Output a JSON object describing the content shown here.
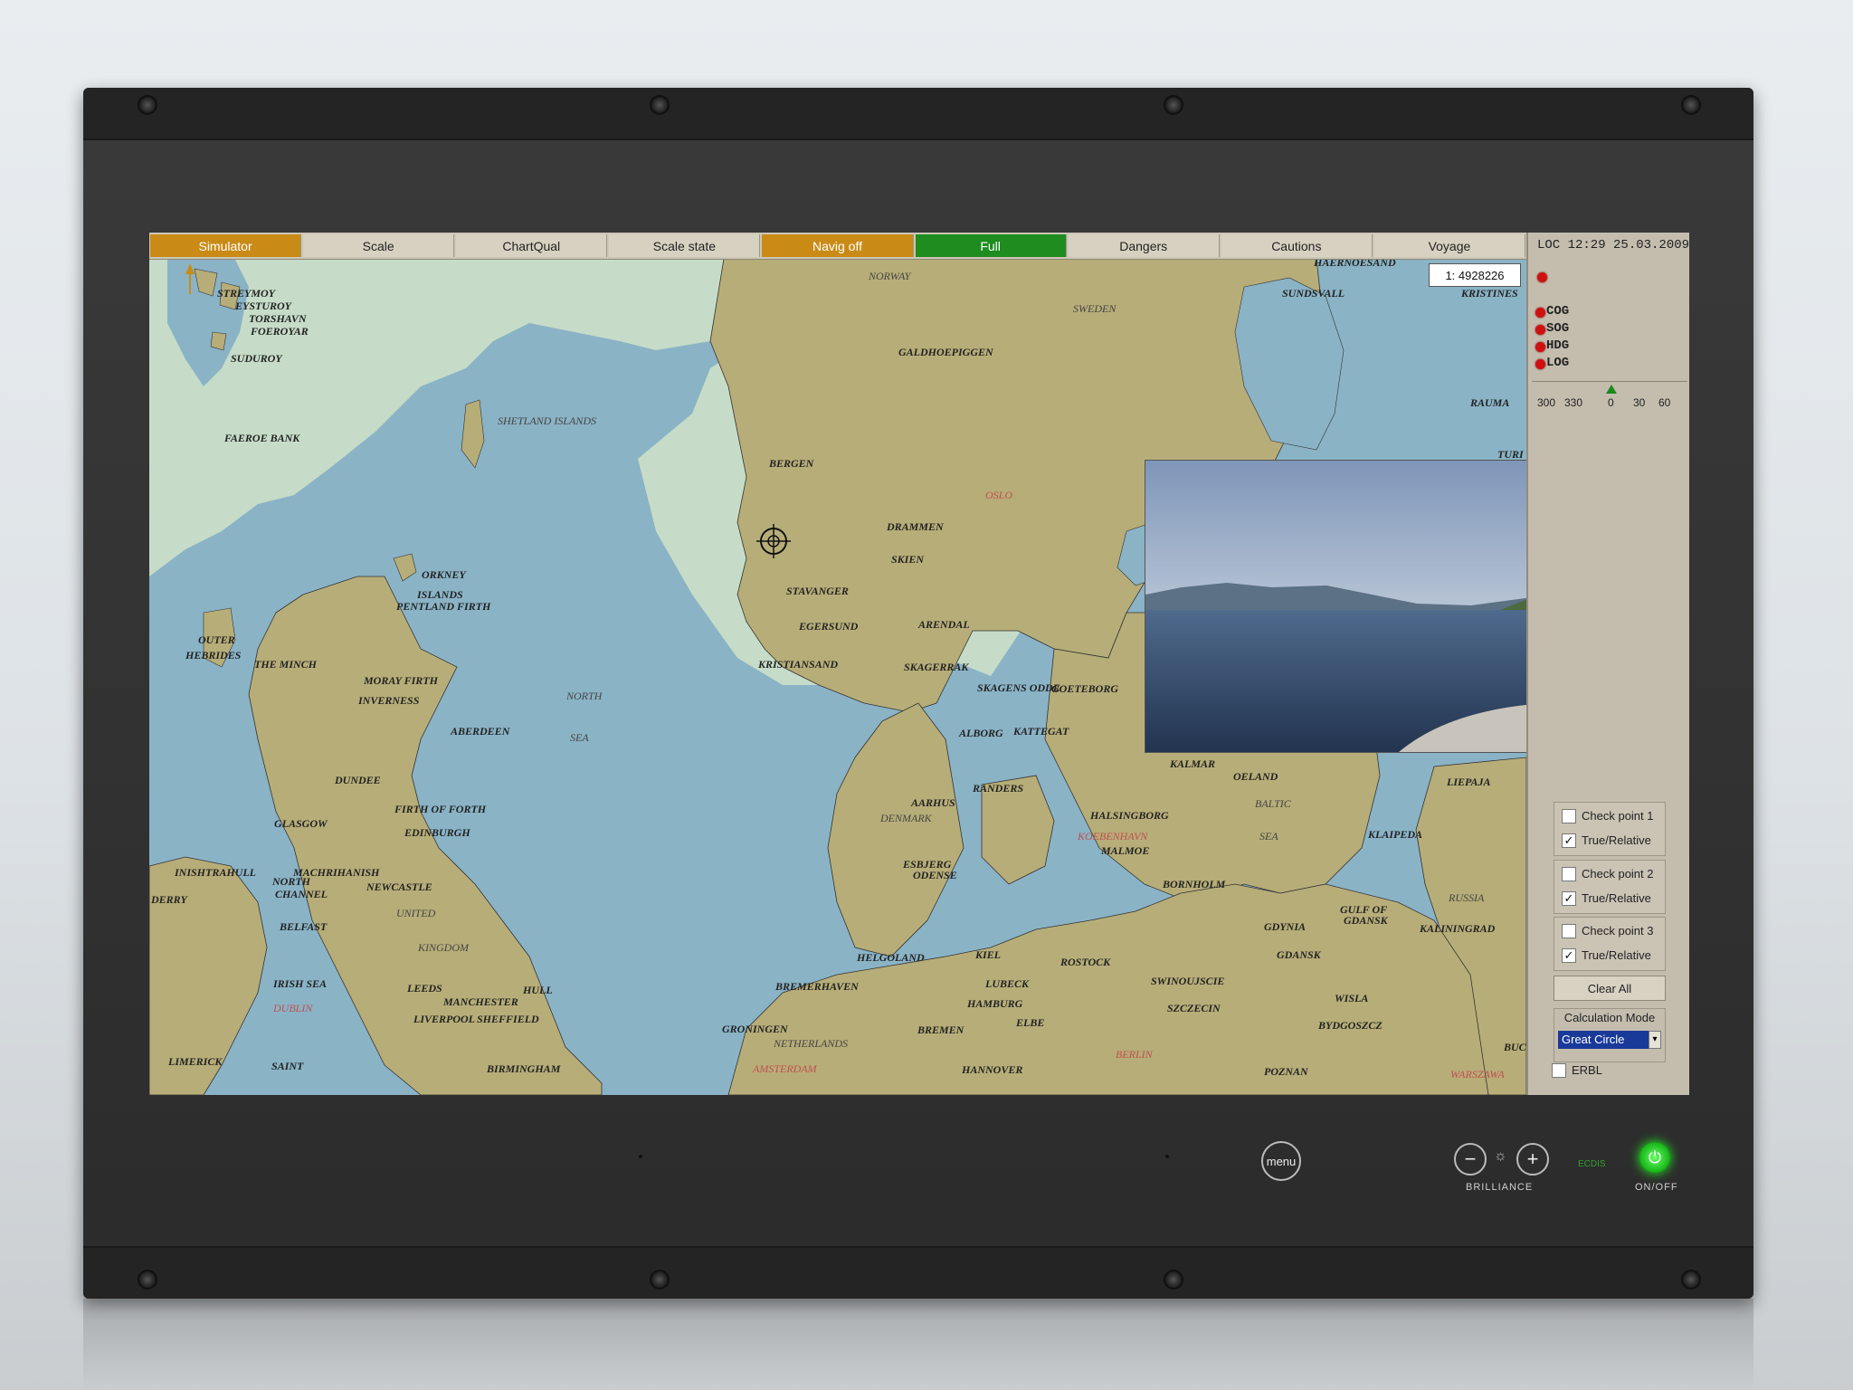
{
  "topbar": {
    "tabs": [
      "Simulator",
      "Scale",
      "ChartQual",
      "Scale state",
      "Navig off",
      "Full",
      "Dangers",
      "Cautions",
      "Voyage"
    ]
  },
  "status": {
    "loc_datetime": "LOC 12:29 25.03.2009",
    "scale": "1: 4928226"
  },
  "sensors": [
    "COG",
    "SOG",
    "HDG",
    "LOG"
  ],
  "compass_ticks": [
    "300",
    "330",
    "0",
    "30",
    "60"
  ],
  "checkpoints": [
    {
      "label": "Check point 1",
      "checked": false,
      "mode_label": "True/Relative",
      "mode_checked": true
    },
    {
      "label": "Check point 2",
      "checked": false,
      "mode_label": "True/Relative",
      "mode_checked": true
    },
    {
      "label": "Check point 3",
      "checked": false,
      "mode_label": "True/Relative",
      "mode_checked": true
    }
  ],
  "clear_all_label": "Clear All",
  "calculation": {
    "label": "Calculation Mode",
    "value": "Great Circle"
  },
  "erbl": {
    "label": "ERBL",
    "checked": false
  },
  "check_mark": "✓",
  "map_labels": {
    "norway": "NORWAY",
    "sweden": "SWEDEN",
    "haernoesand": "HAERNOESAND",
    "sundsvall": "SUNDSVALL",
    "kristines": "KRISTINES",
    "rauma": "RAUMA",
    "turi": "TURI",
    "streymoy": "STREYMOY",
    "eysturoy": "EYSTUROY",
    "torshavn": "TORSHAVN",
    "foeroyar": "FOEROYAR",
    "suduroy": "SUDUROY",
    "faeroe_bank": "FAEROE BANK",
    "shetland": "SHETLAND ISLANDS",
    "galdhoepiggen": "GALDHOEPIGGEN",
    "bergen": "BERGEN",
    "oslo": "OSLO",
    "drammen": "DRAMMEN",
    "skien": "SKIEN",
    "stavanger": "STAVANGER",
    "egersund": "EGERSUND",
    "arendal": "ARENDAL",
    "kristiansand": "KRISTIANSAND",
    "skagerrak": "SKAGERRAK",
    "orkney": "ORKNEY",
    "islands": "ISLANDS",
    "pentland": "PENTLAND FIRTH",
    "outer": "OUTER",
    "hebrides": "HEBRIDES",
    "the_minch": "THE MINCH",
    "moray": "MORAY FIRTH",
    "inverness": "INVERNESS",
    "aberdeen": "ABERDEEN",
    "north": "NORTH",
    "sea": "SEA",
    "skagens_odde": "SKAGENS ODDE",
    "goeteborg": "GOETEBORG",
    "alborg": "ALBORG",
    "kattegat": "KATTEGAT",
    "dundee": "DUNDEE",
    "firth_forth": "FIRTH OF FORTH",
    "edinburgh": "EDINBURGH",
    "glasgow": "GLASGOW",
    "randers": "RANDERS",
    "aarhus": "AARHUS",
    "denmark": "DENMARK",
    "halsingborg": "HALSINGBORG",
    "koebenhavn": "KOEBENHAVN",
    "malmoe": "MALMOE",
    "kalmar": "KALMAR",
    "oeland": "OELAND",
    "baltic": "BALTIC",
    "baltic_sea": "SEA",
    "liepaja": "LIEPAJA",
    "klaipeda": "KLAIPEDA",
    "inishtrahull": "INISHTRAHULL",
    "machrihanish": "MACHRIHANISH",
    "north_channel": "NORTH",
    "channel": "CHANNEL",
    "newcastle": "NEWCASTLE",
    "derry": "DERRY",
    "belfast": "BELFAST",
    "united": "UNITED",
    "kingdom": "KINGDOM",
    "esbjerg": "ESBJERG",
    "odense": "ODENSE",
    "bornholm": "BORNHOLM",
    "gdynia": "GDYNIA",
    "gulf_of": "GULF OF",
    "gdansk_gulf": "GDANSK",
    "kaliningrad": "KALININGRAD",
    "russia": "RUSSIA",
    "gdansk": "GDANSK",
    "helgoland": "HELGOLAND",
    "kiel": "KIEL",
    "rostock": "ROSTOCK",
    "swinoujscie": "SWINOUJSCIE",
    "irish_sea": "IRISH SEA",
    "leeds": "LEEDS",
    "hull": "HULL",
    "manchester": "MANCHESTER",
    "liverpool": "LIVERPOOL",
    "sheffield": "SHEFFIELD",
    "dublin": "DUBLIN",
    "bremerhaven": "BREMERHAVEN",
    "lubeck": "LUBECK",
    "hamburg": "HAMBURG",
    "szczecin": "SZCZECIN",
    "wisla": "WISLA",
    "groningen": "GRONINGEN",
    "netherlands": "NETHERLANDS",
    "bremen": "BREMEN",
    "elbe": "ELBE",
    "bydgoszcz": "BYDGOSZCZ",
    "limerick": "LIMERICK",
    "saint": "SAINT",
    "birmingham": "BIRMINGHAM",
    "amsterdam": "AMSTERDAM",
    "hannover": "HANNOVER",
    "berlin": "BERLIN",
    "poznan": "POZNAN",
    "warszawa": "WARSZAWA",
    "buc": "BUC"
  },
  "bezel": {
    "menu_label": "menu",
    "minus": "−",
    "plus": "+",
    "sun": "☼",
    "brilliance_label": "BRILLIANCE",
    "ecdis_label": "ECDIS",
    "power_glyph": "⏻",
    "onoff_label": "ON/OFF"
  },
  "colors": {
    "land": "#b7ad78",
    "sea": "#8ab3c6",
    "shallow": "#c6dcc8",
    "accent_orange": "#c98b16",
    "accent_green": "#1e8c1e",
    "panel": "#c4bdae"
  }
}
